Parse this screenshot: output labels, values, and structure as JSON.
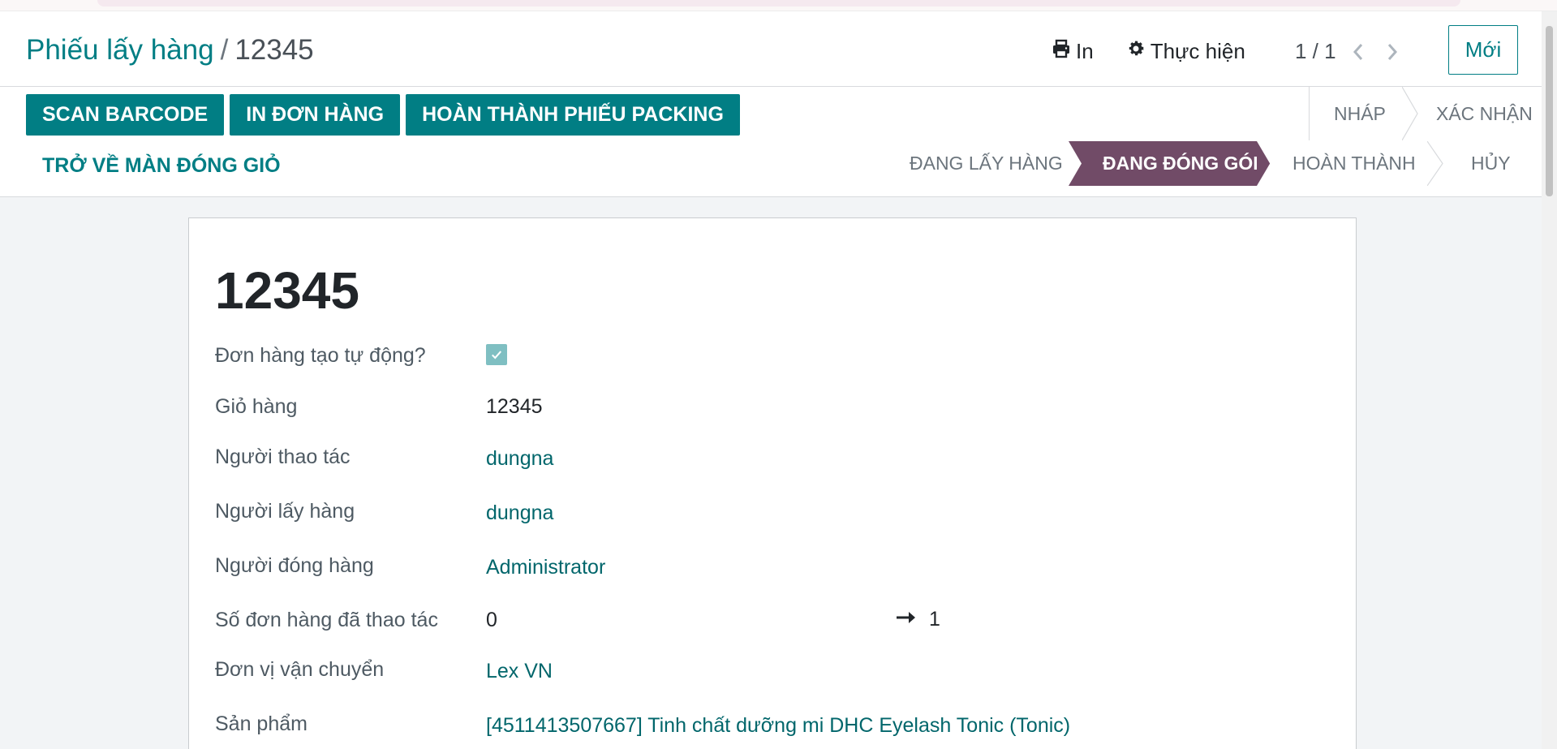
{
  "breadcrumb": {
    "parent": "Phiếu lấy hàng",
    "separator": "/",
    "current": "12345"
  },
  "actions": {
    "print_label": "In",
    "action_label": "Thực hiện"
  },
  "pager": {
    "value": "1 / 1"
  },
  "new_button": "Mới",
  "buttons": {
    "scan_barcode": "SCAN BARCODE",
    "print_orders": "IN ĐƠN HÀNG",
    "complete_packing": "HOÀN THÀNH PHIẾU PACKING",
    "back_to_cart": "TRỞ VỀ MÀN ĐÓNG GIỎ"
  },
  "status": {
    "top": [
      "NHÁP",
      "XÁC NHẬN"
    ],
    "bottom": [
      "ĐANG LẤY HÀNG",
      "ĐANG ĐÓNG GÓI",
      "HOÀN THÀNH",
      "HỦY"
    ],
    "active": "ĐANG ĐÓNG GÓI",
    "active_color": "#714b67"
  },
  "record": {
    "title": "12345",
    "fields": {
      "auto_order_label": "Đơn hàng tạo tự động?",
      "auto_order_checked": true,
      "cart_label": "Giỏ hàng",
      "cart_value": "12345",
      "operator_label": "Người thao tác",
      "operator_value": "dungna",
      "picker_label": "Người lấy hàng",
      "picker_value": "dungna",
      "packer_label": "Người đóng hàng",
      "packer_value": "Administrator",
      "processed_label": "Số đơn hàng đã thao tác",
      "processed_value": "0",
      "processed_target": "1",
      "carrier_label": "Đơn vị vận chuyển",
      "carrier_value": "Lex VN",
      "product_label": "Sản phẩm",
      "product_value": "[4511413507667] Tinh chất dưỡng mi DHC Eyelash Tonic (Tonic)"
    }
  },
  "colors": {
    "primary": "#017e84",
    "accent": "#714b67"
  }
}
